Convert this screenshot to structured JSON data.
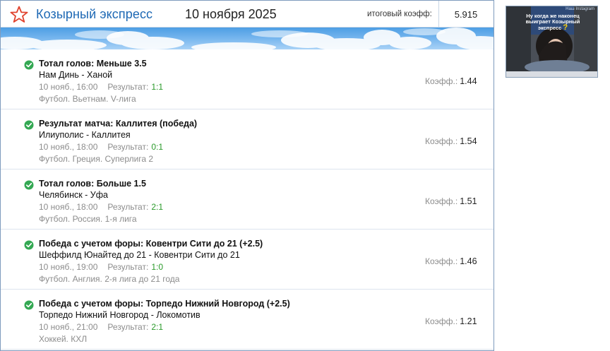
{
  "header": {
    "title": "Козырный экспресс",
    "date": "10 ноября 2025",
    "coef_label": "итоговый коэфф:",
    "coef_value": "5.915"
  },
  "bets": [
    {
      "market": "Тотал голов: Меньше 3.5",
      "teams": "Нам Динь - Ханой",
      "time": "10 нояб., 16:00",
      "result_label": "Результат:",
      "result": "1:1",
      "league": "Футбол. Вьетнам. V-лига",
      "odds_label": "Коэфф.:",
      "odds": "1.44",
      "status_icon": "check-circle-icon"
    },
    {
      "market": "Результат матча: Каллитея (победа)",
      "teams": "Илиуполис - Каллитея",
      "time": "10 нояб., 18:00",
      "result_label": "Результат:",
      "result": "0:1",
      "league": "Футбол. Греция. Суперлига 2",
      "odds_label": "Коэфф.:",
      "odds": "1.54",
      "status_icon": "check-circle-icon"
    },
    {
      "market": "Тотал голов: Больше 1.5",
      "teams": "Челябинск - Уфа",
      "time": "10 нояб., 18:00",
      "result_label": "Результат:",
      "result": "2:1",
      "league": "Футбол. Россия. 1-я лига",
      "odds_label": "Коэфф.:",
      "odds": "1.51",
      "status_icon": "check-circle-icon"
    },
    {
      "market": "Победа с учетом форы: Ковентри Сити до 21 (+2.5)",
      "teams": "Шеффилд Юнайтед до 21 - Ковентри Сити до 21",
      "time": "10 нояб., 19:00",
      "result_label": "Результат:",
      "result": "1:0",
      "league": "Футбол. Англия. 2-я лига до 21 года",
      "odds_label": "Коэфф.:",
      "odds": "1.46",
      "status_icon": "check-circle-icon"
    },
    {
      "market": "Победа с учетом форы: Торпедо Нижний Новгород (+2.5)",
      "teams": "Торпедо Нижний Новгород - Локомотив",
      "time": "10 нояб., 21:00",
      "result_label": "Результат:",
      "result": "2:1",
      "league": "Хоккей. КХЛ",
      "odds_label": "Коэфф.:",
      "odds": "1.21",
      "status_icon": "check-circle-icon"
    }
  ],
  "ad": {
    "top_text": "Наш Instagram",
    "caption": "Ну когда же наконец выиграет Козырный экспресс",
    "caption_mark": "?"
  },
  "colors": {
    "brand_blue": "#1d68b4",
    "star_red": "#e0412c",
    "win_green": "#2a9a2a",
    "check_green": "#34a853"
  },
  "icons": {
    "logo": "star-outline-icon",
    "status": "check-circle-icon"
  }
}
